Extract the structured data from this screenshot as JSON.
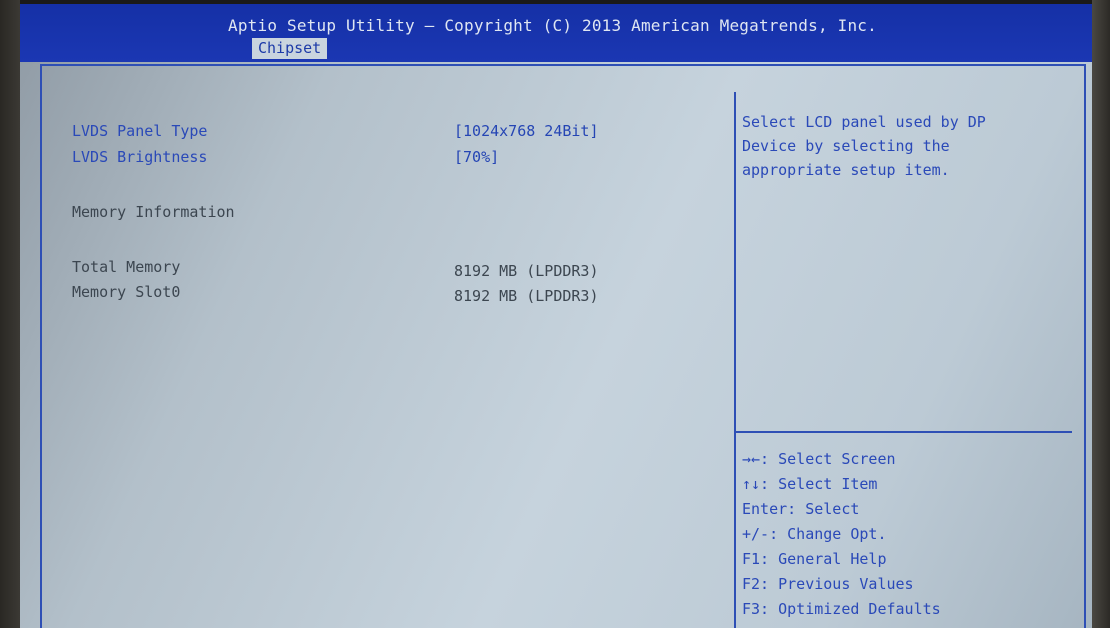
{
  "header": {
    "title": "Aptio Setup Utility – Copyright (C) 2013 American Megatrends, Inc.",
    "active_tab": "Chipset"
  },
  "settings": [
    {
      "label": "LVDS Panel Type",
      "value": "[1024x768   24Bit]"
    },
    {
      "label": "LVDS Brightness",
      "value": "[70%]"
    }
  ],
  "memory": {
    "section_title": "Memory Information",
    "rows": [
      {
        "label": "Total Memory",
        "value": "8192 MB (LPDDR3)"
      },
      {
        "label": "Memory Slot0",
        "value": "8192 MB (LPDDR3)"
      }
    ]
  },
  "help": {
    "lines": [
      "Select LCD panel used by DP",
      "Device by selecting the",
      "appropriate setup item."
    ]
  },
  "keys": [
    "→←: Select Screen",
    "↑↓: Select Item",
    "Enter: Select",
    "+/-: Change Opt.",
    "F1: General Help",
    "F2: Previous Values",
    "F3: Optimized Defaults"
  ],
  "colors": {
    "header_bg": "#1530a6",
    "screen_bg": "#c6d3dd",
    "accent_blue": "#2a49b8",
    "text_dark": "#3c4650"
  }
}
